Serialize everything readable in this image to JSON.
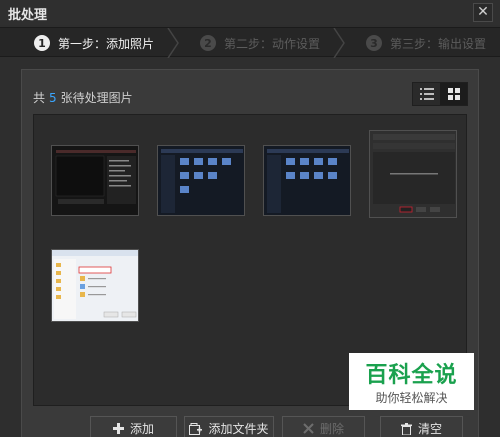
{
  "window": {
    "title": "批处理"
  },
  "steps": [
    {
      "number": "1",
      "label": "第一步：添加照片",
      "active": true
    },
    {
      "number": "2",
      "label": "第二步：动作设置",
      "active": false
    },
    {
      "number": "3",
      "label": "第三步：输出设置",
      "active": false
    }
  ],
  "panel": {
    "count_prefix": "共",
    "count_value": "5",
    "count_suffix": "张待处理图片",
    "view_toggle": {
      "selected": "grid"
    }
  },
  "thumbnails": [
    {
      "kind": "dark-app-screenshot"
    },
    {
      "kind": "blue-folder-screenshot"
    },
    {
      "kind": "blue-folder-screenshot"
    },
    {
      "kind": "dark-dialog-screenshot"
    },
    {
      "kind": "file-dialog-screenshot"
    }
  ],
  "buttons": {
    "add": "添加",
    "add_folder": "添加文件夹",
    "delete": "删除",
    "clear": "清空"
  },
  "watermark": {
    "main": "百科全说",
    "sub": "助你轻松解决"
  },
  "colors": {
    "accent": "#3aa6ff",
    "watermark_green": "#1aa14e"
  }
}
